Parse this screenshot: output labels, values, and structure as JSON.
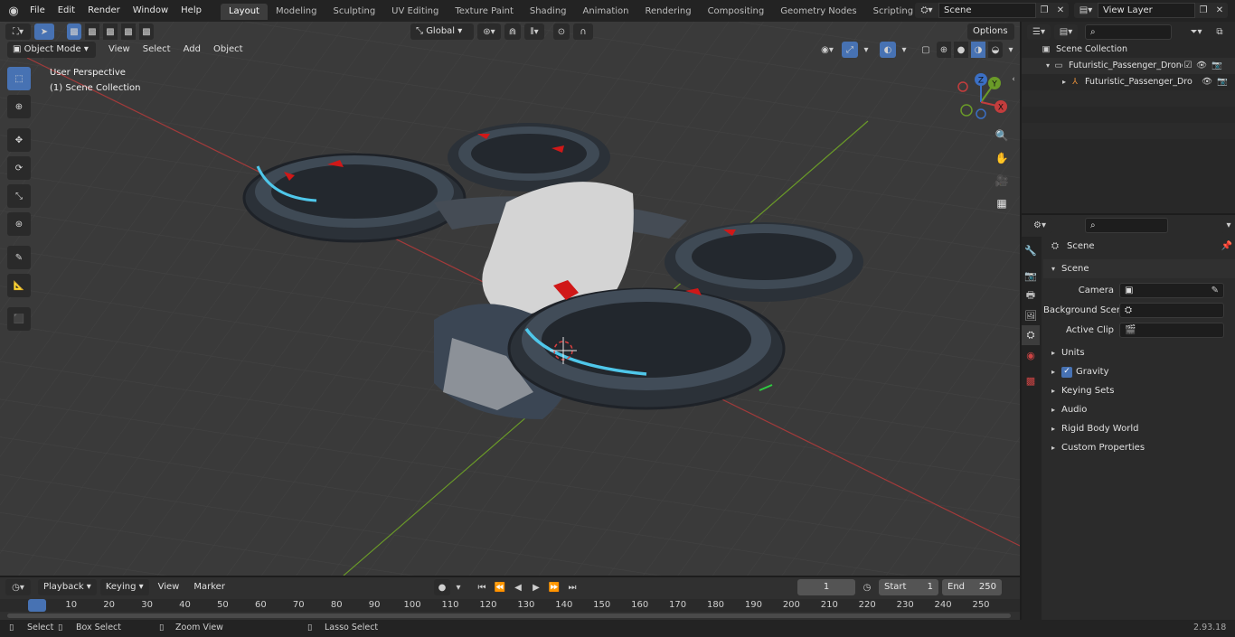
{
  "topbar": {
    "menus": [
      "File",
      "Edit",
      "Render",
      "Window",
      "Help"
    ],
    "workspace_tabs": [
      "Layout",
      "Modeling",
      "Sculpting",
      "UV Editing",
      "Texture Paint",
      "Shading",
      "Animation",
      "Rendering",
      "Compositing",
      "Geometry Nodes",
      "Scripting"
    ],
    "active_tab": "Layout",
    "scene_name": "Scene",
    "view_layer": "View Layer"
  },
  "viewport": {
    "mode": "Object Mode",
    "menus": [
      "View",
      "Select",
      "Add",
      "Object"
    ],
    "transform_orientation": "Global",
    "options_label": "Options",
    "view_name": "User Perspective",
    "collection_label": "(1) Scene Collection",
    "gizmo": {
      "x": "X",
      "y": "Y",
      "z": "Z"
    }
  },
  "outliner": {
    "root": "Scene Collection",
    "items": [
      {
        "label": "Futuristic_Passenger_Drone_C"
      },
      {
        "label": "Futuristic_Passenger_Dro"
      }
    ]
  },
  "properties": {
    "header": "Scene",
    "section": "Scene",
    "fields": [
      {
        "label": "Camera"
      },
      {
        "label": "Background Scene"
      },
      {
        "label": "Active Clip"
      }
    ],
    "panels": [
      "Units",
      "Gravity",
      "Keying Sets",
      "Audio",
      "Rigid Body World",
      "Custom Properties"
    ]
  },
  "timeline": {
    "menus": [
      "Playback",
      "Keying",
      "View",
      "Marker"
    ],
    "current_frame": "1",
    "start_label": "Start",
    "start_value": "1",
    "end_label": "End",
    "end_value": "250",
    "ticks": [
      "1",
      "10",
      "20",
      "30",
      "40",
      "50",
      "60",
      "70",
      "80",
      "90",
      "100",
      "110",
      "120",
      "130",
      "140",
      "150",
      "160",
      "170",
      "180",
      "190",
      "200",
      "210",
      "220",
      "230",
      "240",
      "250"
    ]
  },
  "statusbar": {
    "select": "Select",
    "box_select": "Box Select",
    "zoom_view": "Zoom View",
    "lasso_select": "Lasso Select",
    "version": "2.93.18"
  },
  "colors": {
    "accent": "#4772b3",
    "axis_red": "#c33d3d",
    "axis_green": "#7fb32a",
    "rotor_glow": "#4fc7ea",
    "rotor_red": "#d01818"
  }
}
